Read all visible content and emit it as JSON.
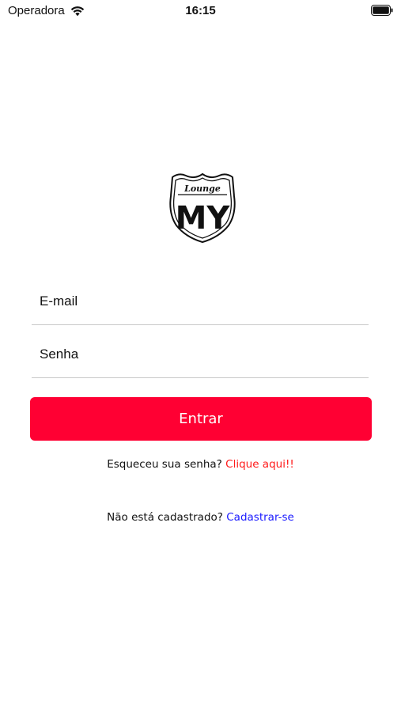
{
  "status_bar": {
    "carrier": "Operadora",
    "time": "16:15",
    "wifi_icon": "wifi-icon",
    "battery_icon": "battery-icon"
  },
  "logo": {
    "text_top": "Lounge",
    "text_main": "MY",
    "icon": "shield-logo"
  },
  "form": {
    "email_placeholder": "E-mail",
    "email_value": "",
    "password_placeholder": "Senha",
    "password_value": ""
  },
  "login_button": {
    "label": "Entrar",
    "color": "#ff0033"
  },
  "forgot": {
    "text": "Esqueceu sua senha?",
    "link": "Clique aqui!!",
    "link_color": "#ff1a1a"
  },
  "signup": {
    "text": "Não está cadastrado?",
    "link": "Cadastrar-se",
    "link_color": "#1a1aff"
  }
}
